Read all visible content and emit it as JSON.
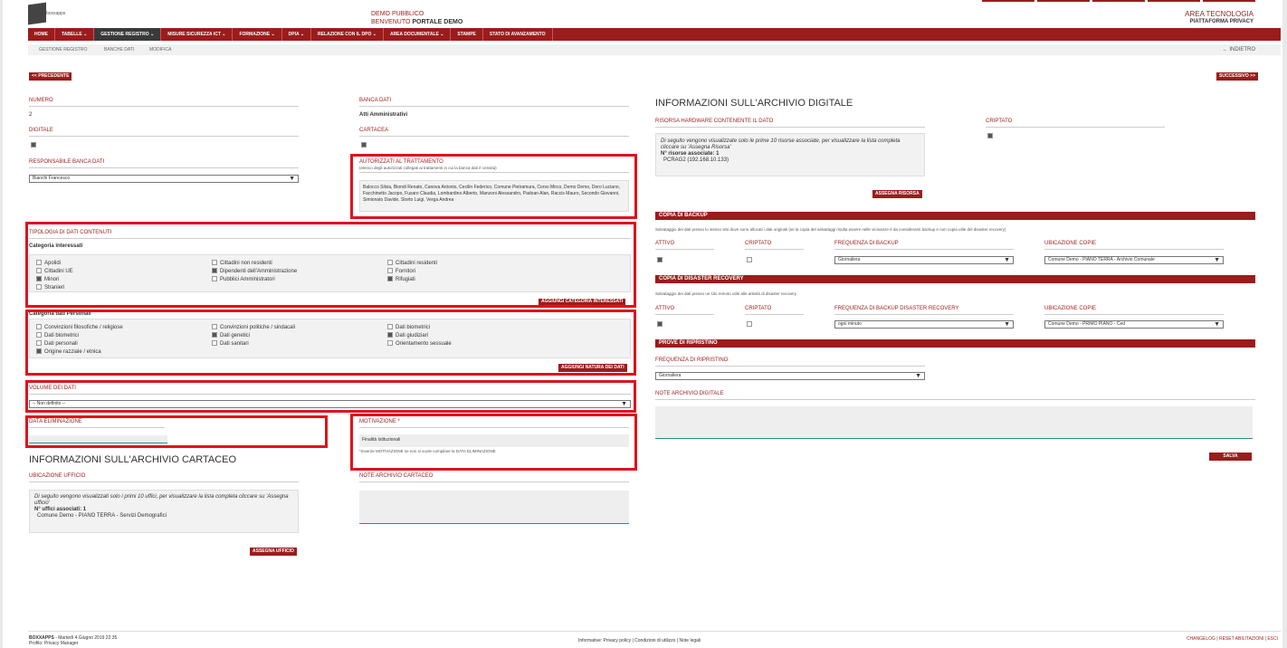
{
  "header": {
    "logo_text": "boxxapps",
    "center_line1": "DEMO PUBBLICO",
    "center_line2_prefix": "BENVENUTO",
    "center_line2_name": "PORTALE DEMO",
    "right_line1": "AREA TECNOLOGIA",
    "right_line2": "PIATTAFORMA PRIVACY"
  },
  "nav": [
    {
      "label": "HOME"
    },
    {
      "label": "TABELLE ⌄"
    },
    {
      "label": "GESTIONE REGISTRO ⌄"
    },
    {
      "label": "MISURE SICUREZZA ICT ⌄"
    },
    {
      "label": "FORMAZIONE ⌄"
    },
    {
      "label": "DPIA ⌄"
    },
    {
      "label": "RELAZIONE CON IL DPO ⌄"
    },
    {
      "label": "AREA DOCUMENTALE ⌄"
    },
    {
      "label": "STAMPE"
    },
    {
      "label": "STATO DI AVANZAMENTO"
    }
  ],
  "breadcrumb": [
    "GESTIONE REGISTRO",
    "BANCHE DATI",
    "MODIFICA"
  ],
  "back_label": "INDIETRO",
  "buttons": {
    "prev": "<< PRECEDENTE",
    "next": "SUCCESSIVO >>",
    "assign_resource": "ASSEGNA RISORSA",
    "add_category": "AGGIUNGI CATEGORIA INTERESSATI",
    "add_nature": "AGGIUNGI NATURA DEI DATI",
    "save": "SALVA",
    "assign_office": "ASSEGNA UFFICIO"
  },
  "left": {
    "numero_label": "NUMERO",
    "numero_value": "2",
    "digitale_label": "DIGITALE",
    "responsabile_label": "RESPONSABILE BANCA DATI",
    "responsabile_value": "Bianchi Francesco",
    "banca_label": "BANCA DATI",
    "banca_value": "Atti Amministrativi",
    "cartacea_label": "CARTACEA",
    "autorizzati_label": "AUTORIZZATI AL TRATTAMENTO",
    "autorizzati_note": "(elenco degli autorizzati collegati ai trattamenti in cui la banca dati è censita)",
    "autorizzati_text": "Balocco Silvia, Biondi Renato, Canova Antonio, Cecilin Federico, Comune Pietramura, Corso Mirco, Demo Demo, Doro Luciano, Facchinetto Jacopo, Fusaro Claudia, Lombardino Alberto, Manzoni Alessandro, Padoan Alan, Raccis Mauro, Secondo Giovanni, Simionato Davide, Storto Luigi, Verga Andrea",
    "tipologia_label": "TIPOLOGIA DI DATI CONTENUTI",
    "cat_interessati_title": "Categoria interessati",
    "cat_interessati": [
      {
        "label": "Apolidi",
        "on": false
      },
      {
        "label": "Cittadini non residenti",
        "on": false
      },
      {
        "label": "Cittadini residenti",
        "on": false
      },
      {
        "label": "Cittadini UE",
        "on": false
      },
      {
        "label": "Dipendenti dell'Amministrazione",
        "on": true
      },
      {
        "label": "Fornitori",
        "on": false
      },
      {
        "label": "Minori",
        "on": true
      },
      {
        "label": "Pubblici Amministratori",
        "on": false
      },
      {
        "label": "Rifugiati",
        "on": true
      },
      {
        "label": "Stranieri",
        "on": false
      }
    ],
    "cat_personali_title": "Categoria dati Personali",
    "cat_personali": [
      {
        "label": "Convinzioni filosofiche / religiose",
        "on": false
      },
      {
        "label": "Convinzioni politiche / sindacali",
        "on": false
      },
      {
        "label": "Dati biometrici",
        "on": false
      },
      {
        "label": "Dati biometrici",
        "on": false
      },
      {
        "label": "Dati genetici",
        "on": true
      },
      {
        "label": "Dati giudiziari",
        "on": true
      },
      {
        "label": "Dati personali",
        "on": false
      },
      {
        "label": "Dati sanitari",
        "on": false
      },
      {
        "label": "Orientamento sessuale",
        "on": false
      },
      {
        "label": "Origine razziale / etnica",
        "on": true
      }
    ],
    "volume_label": "VOLUME DEI DATI",
    "volume_value": "-- Non definito --",
    "eliminazione_label": "DATA ELIMINAZIONE",
    "motivazione_label": "MOTIVAZIONE *",
    "motivazione_value": "Finalità Istituzionali",
    "motivazione_hint": "*Inserire MOTIVAZIONE se non si vuole compilare la DATA ELIMINAZIONE",
    "cartaceo_title": "INFORMAZIONI SULL'ARCHIVIO CARTACEO",
    "ufficio_label": "UBICAZIONE UFFICIO",
    "ufficio_info": "Di seguito vengono visualizzati solo i primi 10 uffici, per visualizzare la lista completa cliccare su 'Assegna ufficio'",
    "ufficio_count": "N° uffici associati: 1",
    "ufficio_item": "Comune Demo - PIANO TERRA - Servizi Demografici",
    "note_cartaceo_label": "NOTE ARCHIVIO CARTACEO"
  },
  "right": {
    "title": "INFORMAZIONI SULL'ARCHIVIO DIGITALE",
    "risorsa_label": "RISORSA HARDWARE CONTENENTE IL DATO",
    "criptato_label": "CRIPTATO",
    "risorsa_info": "Di seguito vengono visualizzate solo le prime 10 risorse associate, per visualizzare la lista completa cliccare su 'Assegna Risorsa'",
    "risorsa_count": "N° risorse associate: 1",
    "risorsa_item": "PCRAG2 (192.168.10.133)",
    "backup_title": "COPIA DI BACKUP",
    "backup_desc": "Salvataggio dei dati presso lo stesso sito dove sono allocati i dati originali (se la copia del salvataggi risulta essere nelle vicinanze è da considerarsi backup e non copia utile del disaster recovery)",
    "attivo_label": "ATTIVO",
    "freq_backup_label": "FREQUENZA DI BACKUP",
    "freq_backup_value": "Giornaliera",
    "ubicazione_label": "UBICAZIONE COPIE",
    "ubicazione_backup_value": "Comune Demo - PIANO TERRA - Archivio Comunale",
    "dr_title": "COPIA DI DISASTER RECOVERY",
    "dr_desc": "Salvataggio dei dati presso un sito remoto utile alle attività di disaster recovery",
    "freq_dr_label": "FREQUENZA DI BACKUP DISASTER RECOVERY",
    "freq_dr_value": "ogni minuto",
    "ubicazione_dr_value": "Comune Demo - PRIMO PIANO - Ced",
    "ripristino_title": "PROVE DI RIPRISTINO",
    "freq_ripristino_label": "FREQUENZA DI RIPRISTINO",
    "freq_ripristino_value": "Giornaliera",
    "note_digitale_label": "NOTE ARCHIVIO DIGITALE"
  },
  "footer": {
    "brand": "BOXXAPPS",
    "date": "- Martedì 4 Giugno 2019 22:35",
    "profile": "Profilo: Privacy Manager",
    "center": "Informative: Privacy policy | Condizioni di utilizzo | Note legali",
    "right": "CHANGELOG | RESET ABILITAZIONI | ESCI"
  }
}
